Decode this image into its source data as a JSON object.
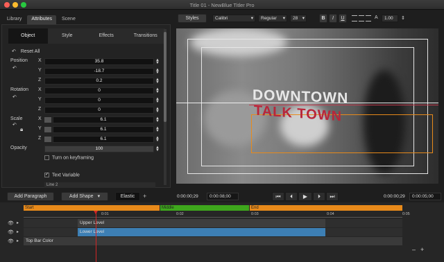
{
  "window": {
    "title": "Title 01 - NewBlue Titler Pro"
  },
  "left_tabs": [
    "Library",
    "Attributes",
    "Scene"
  ],
  "sub_tabs": [
    "Object",
    "Style",
    "Effects",
    "Transitions"
  ],
  "reset_all": "Reset All",
  "properties": {
    "position": {
      "label": "Position",
      "x": "35.8",
      "y": "-18.7",
      "z": "0.2"
    },
    "rotation": {
      "label": "Rotation",
      "x": "0",
      "y": "0",
      "z": "0"
    },
    "scale": {
      "label": "Scale",
      "x": "6.1",
      "y": "6.1",
      "z": "6.1"
    },
    "opacity": {
      "label": "Opacity",
      "value": "100"
    },
    "axes": {
      "x": "X",
      "y": "Y",
      "z": "Z"
    }
  },
  "keyframing": {
    "label": "Turn on keyframing",
    "checked": false
  },
  "text_variable": {
    "label": "Text Variable",
    "checked": true
  },
  "line_label": "Line 2",
  "toolbar": {
    "styles": "Styles",
    "font": "Calibri",
    "weight": "Regular",
    "size": "28",
    "bold": "B",
    "italic": "I",
    "underline": "U",
    "spacing_icon": "A",
    "line_height": "1.00"
  },
  "preview": {
    "line1": "DOWNTOWN",
    "line2": "TALK TOWN"
  },
  "bottom": {
    "add_paragraph": "Add Paragraph",
    "add_shape": "Add Shape",
    "elastic": "Elastic",
    "plus": "+",
    "left_timecode": "0:00:00;29",
    "duration_timecode": "0:00:08;00",
    "right_timecode": "0:00:00;29",
    "right_duration": "0:00:05;00"
  },
  "timeline": {
    "segments": {
      "start": "Start",
      "middle": "Middle",
      "end": "End"
    },
    "ticks": [
      "0:01",
      "0:02",
      "0:03",
      "0:04",
      "0:05"
    ],
    "tracks": [
      "Upper Level",
      "Lower Level",
      "Top Bar Color"
    ],
    "zoom_minus": "–",
    "zoom_plus": "+"
  },
  "colors": {
    "accent_orange": "#e88a1a",
    "middle_green": "#3ea71c",
    "lower_blue": "#3d7fb4",
    "title_red": "#b8263a",
    "playhead": "#d42525"
  }
}
